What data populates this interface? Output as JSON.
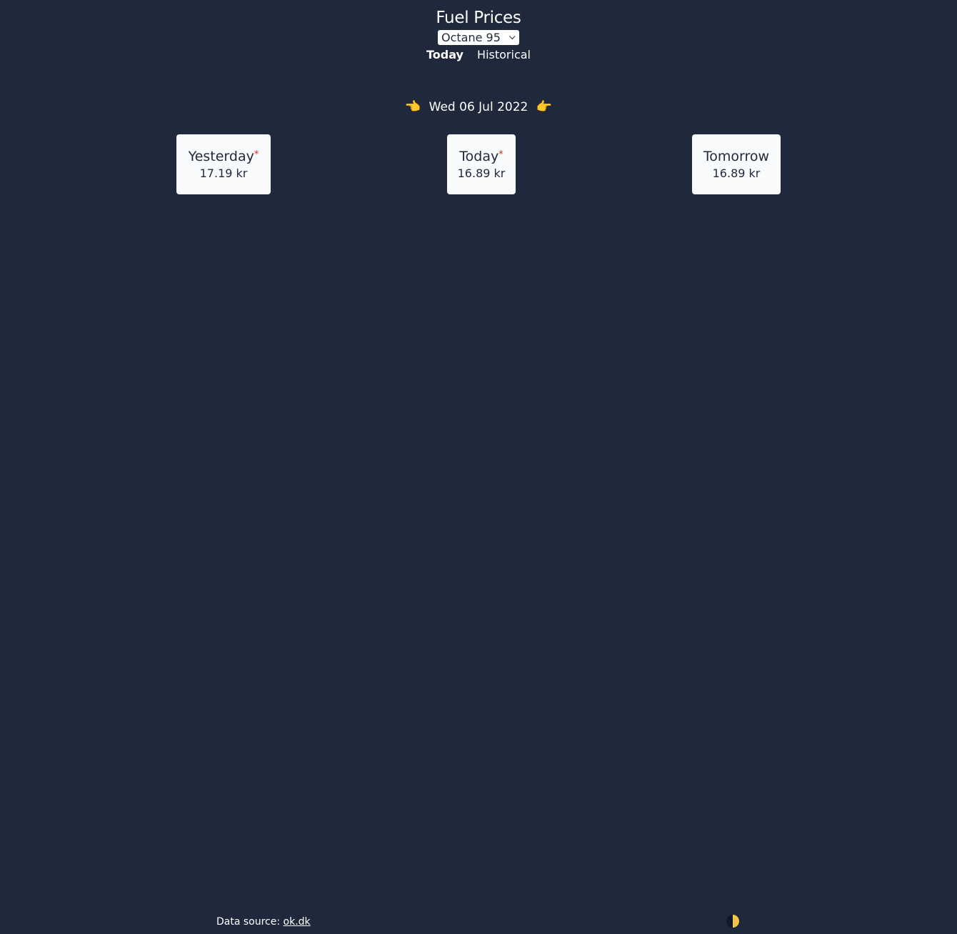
{
  "header": {
    "title": "Fuel Prices",
    "fuel_select": {
      "selected": "Octane 95"
    },
    "tabs": [
      {
        "label": "Today",
        "active": true
      },
      {
        "label": "Historical",
        "active": false
      }
    ]
  },
  "date_nav": {
    "prev_icon": "left-pointing-hand",
    "prev_glyph": "👈",
    "date": "Wed 06 Jul 2022",
    "next_icon": "right-pointing-hand",
    "next_glyph": "👉"
  },
  "cards": [
    {
      "label": "Yesterday",
      "star": "*",
      "price": "17.19 kr"
    },
    {
      "label": "Today",
      "star": "*",
      "price": "16.89 kr"
    },
    {
      "label": "Tomorrow",
      "star": "",
      "price": "16.89 kr"
    }
  ],
  "footer": {
    "source_prefix": "Data source:",
    "source_link": "ok.dk",
    "theme_toggle_icon": "half-moon-icon"
  },
  "colors": {
    "background": "#1f293b",
    "card_background": "#f8fafc",
    "asterisk": "#e02424",
    "accent": "#f3c34a"
  }
}
